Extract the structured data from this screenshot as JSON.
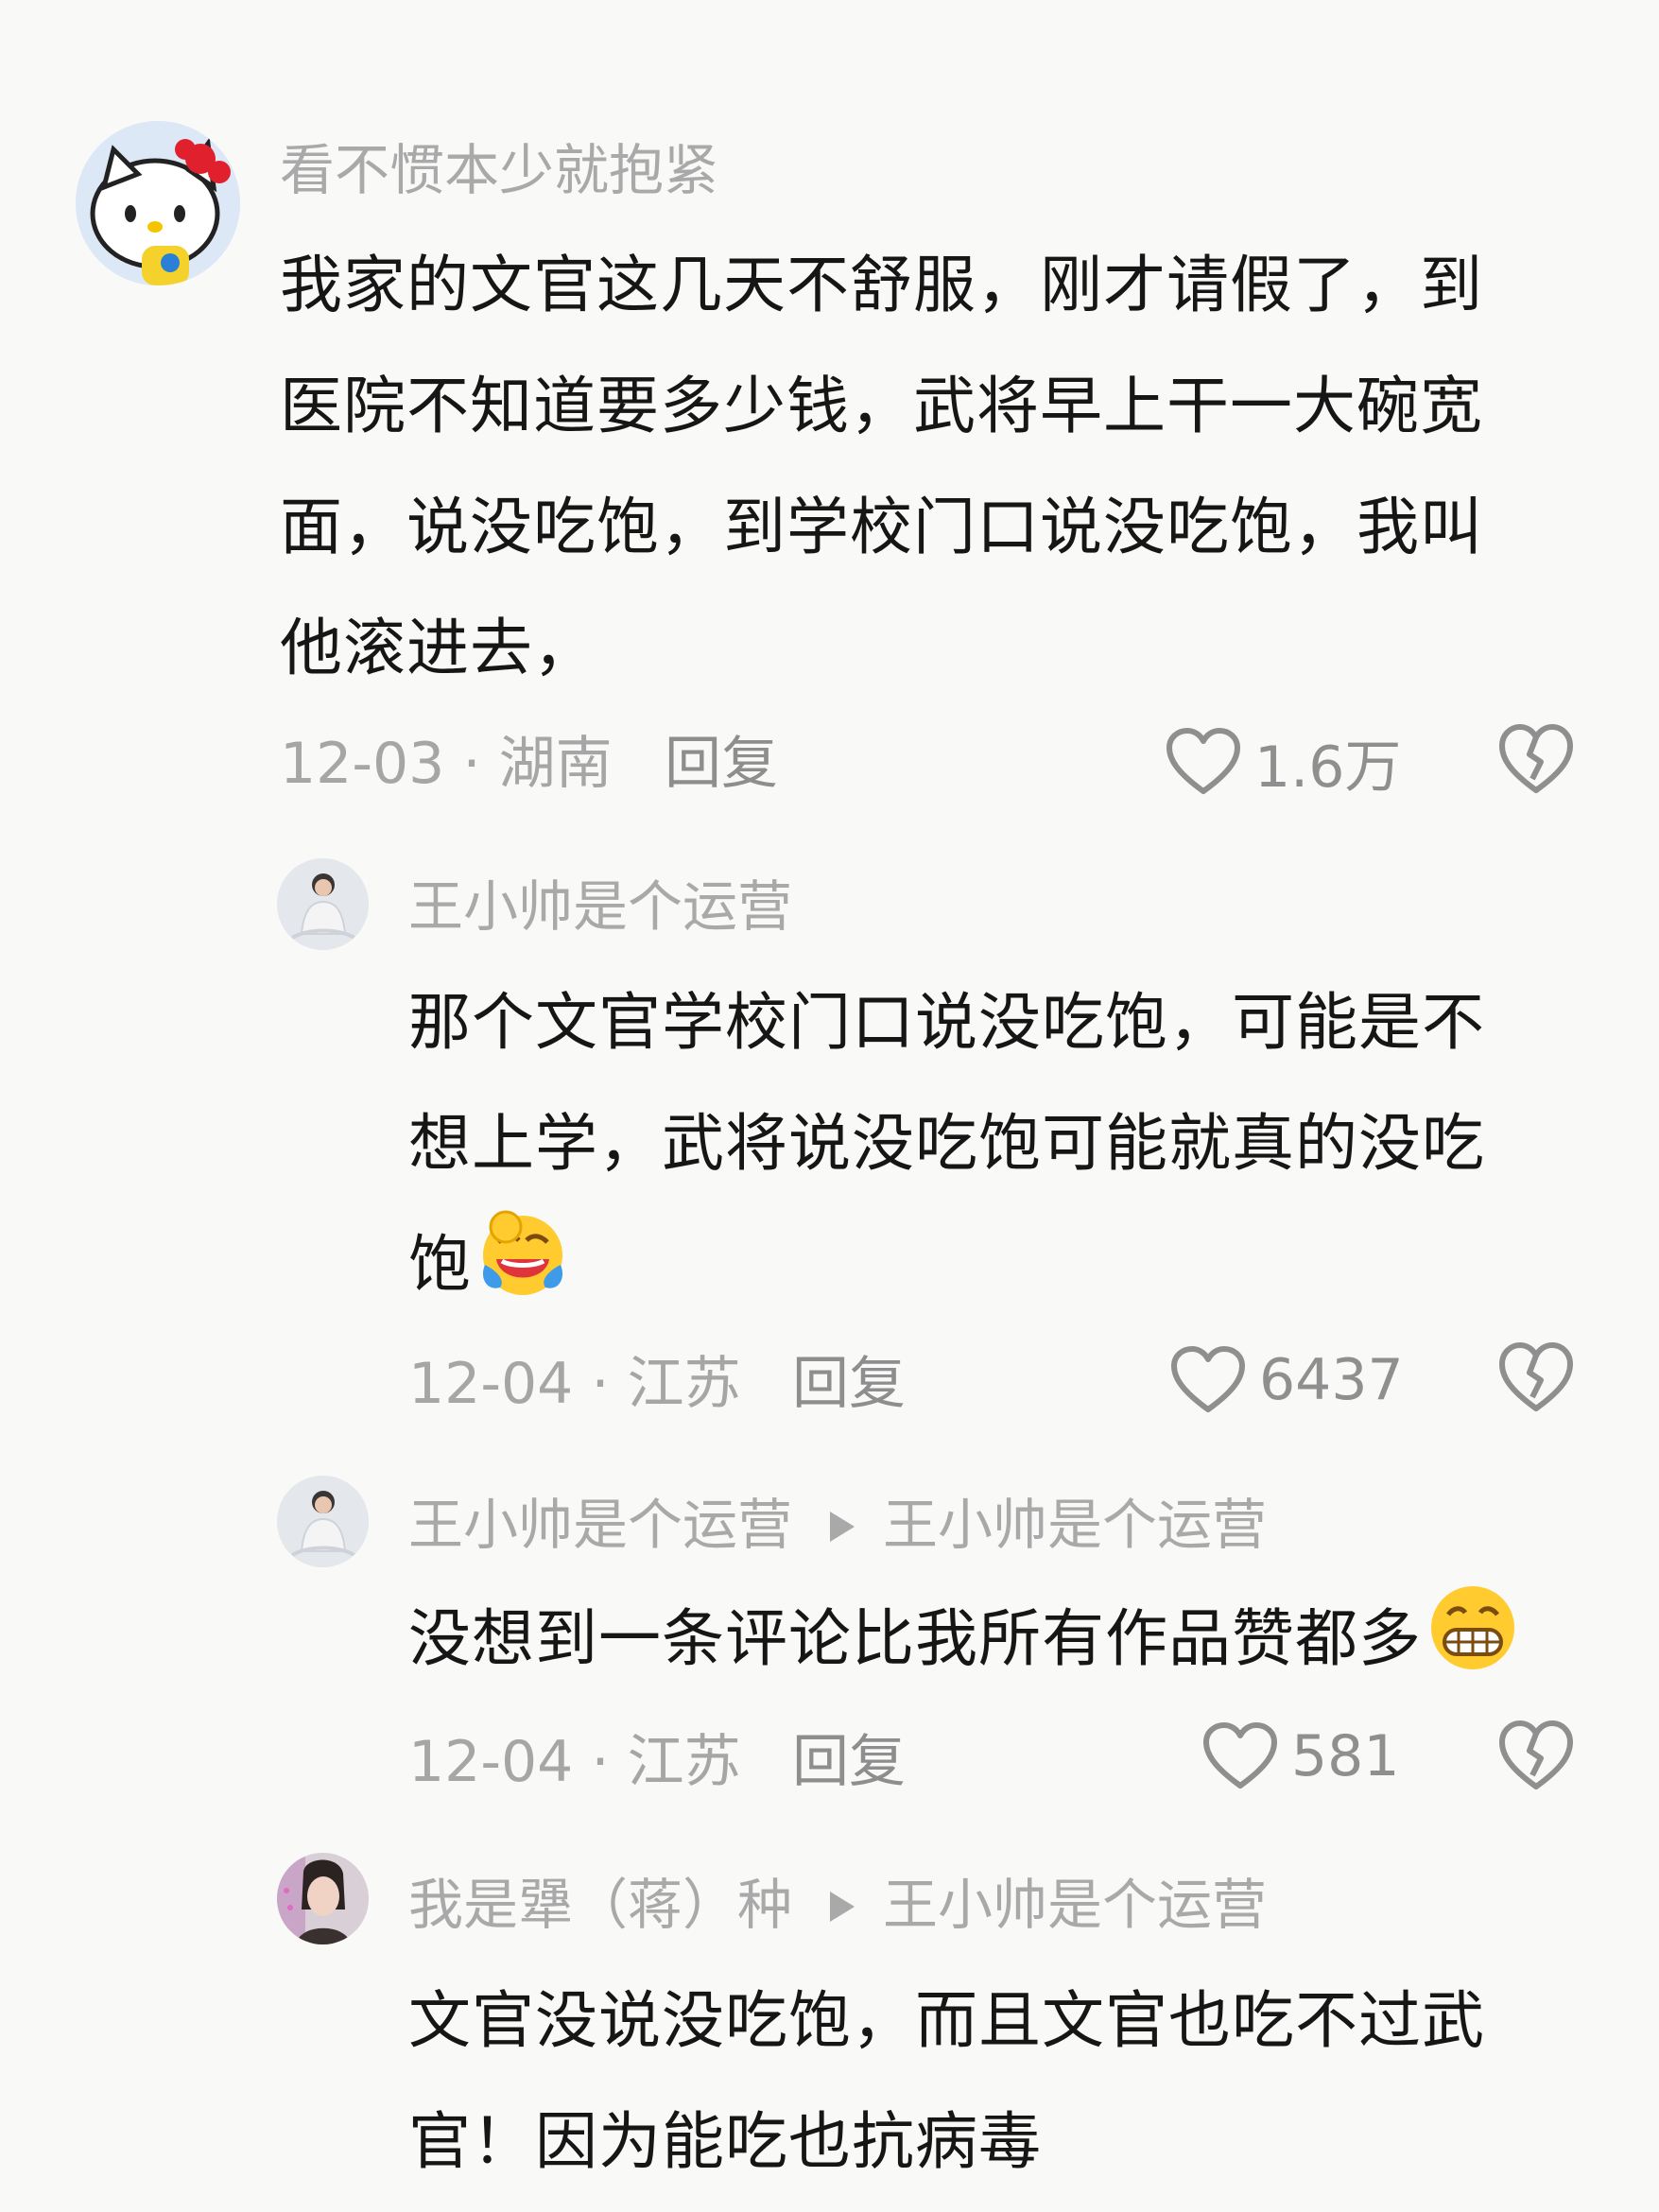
{
  "comments": [
    {
      "username": "看不惯本少就抱紧",
      "text_lines": [
        "我家的文官这几天不舒服，刚才请假了，到",
        "医院不知道要多少钱，武将早上干一大碗宽",
        "面，说没吃饱，到学校门口说没吃饱，我叫",
        "他滚进去，"
      ],
      "date": "12-03",
      "location": "湖南",
      "reply_label": "回复",
      "likes": "1.6万"
    },
    {
      "username": "王小帅是个运营",
      "text_lines": [
        "那个文官学校门口说没吃饱，可能是不",
        "想上学，武将说没吃饱可能就真的没吃",
        "饱"
      ],
      "emoji": "crying-laughing-emoji",
      "date": "12-04",
      "location": "江苏",
      "reply_label": "回复",
      "likes": "6437"
    },
    {
      "username": "王小帅是个运营",
      "reply_to": "王小帅是个运营",
      "text_lines": [
        "没想到一条评论比我所有作品赞都多"
      ],
      "emoji": "grinning-emoji",
      "date": "12-04",
      "location": "江苏",
      "reply_label": "回复",
      "likes": "581"
    },
    {
      "username": "我是犟（蒋）种",
      "reply_to": "王小帅是个运营",
      "text_lines": [
        "文官没说没吃饱，而且文官也吃不过武",
        "官！因为能吃也抗病毒"
      ]
    }
  ],
  "separator": "·",
  "colors": {
    "meta_gray": "#a6a6a6",
    "text": "#161616",
    "background": "#f9f9f8"
  }
}
